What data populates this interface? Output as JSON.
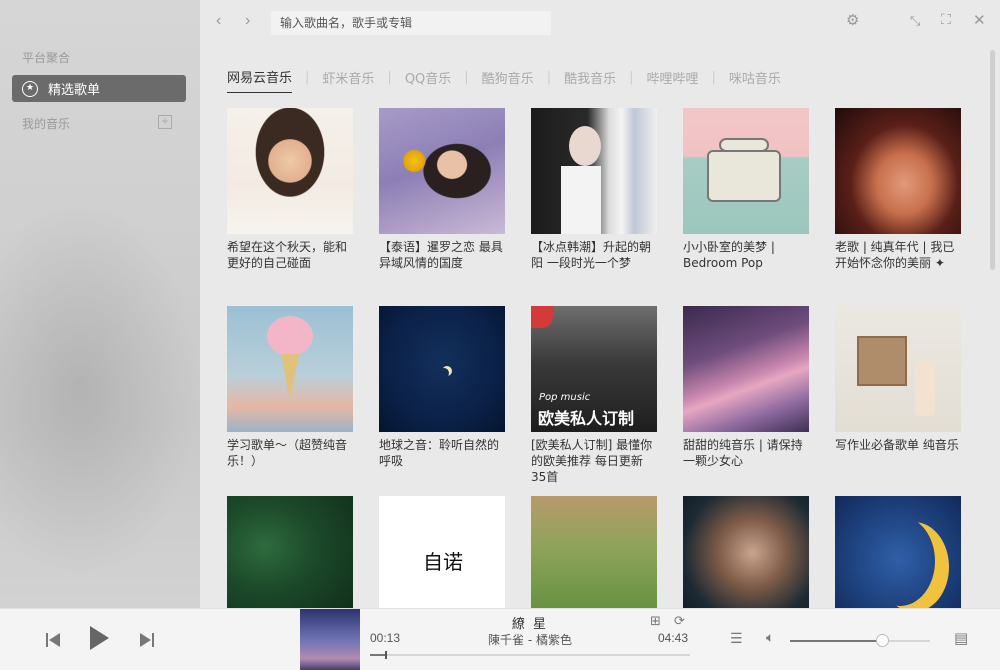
{
  "sidebar": {
    "section1": "平台聚合",
    "selected_item": "精选歌单",
    "section2": "我的音乐"
  },
  "topbar": {
    "search_placeholder": "输入歌曲名，歌手或专辑"
  },
  "tabs": [
    {
      "label": "网易云音乐",
      "active": true
    },
    {
      "label": "虾米音乐",
      "active": false
    },
    {
      "label": "QQ音乐",
      "active": false
    },
    {
      "label": "酷狗音乐",
      "active": false
    },
    {
      "label": "酷我音乐",
      "active": false
    },
    {
      "label": "哔哩哔哩",
      "active": false
    },
    {
      "label": "咪咕音乐",
      "active": false
    }
  ],
  "playlists": [
    {
      "title": "希望在这个秋天，能和更好的自己碰面",
      "cover_text": ""
    },
    {
      "title": "【泰语】暹罗之恋 最具异域风情的国度",
      "cover_text": ""
    },
    {
      "title": "【冰点韩潮】升起的朝阳 一段时光一个梦",
      "cover_text": ""
    },
    {
      "title": "小小卧室的美梦 | Bedroom Pop",
      "cover_text": ""
    },
    {
      "title": "老歌 | 纯真年代 | 我已开始怀念你的美丽 ✦",
      "cover_text": ""
    },
    {
      "title": "学习歌单～（超赞纯音乐！）",
      "cover_text": ""
    },
    {
      "title": "地球之音：聆听自然的呼吸",
      "cover_text": ""
    },
    {
      "title": "[欧美私人订制] 最懂你的欧美推荐 每日更新35首",
      "cover_text": "Pop music",
      "cover_text2": "欧美私人订制"
    },
    {
      "title": "甜甜的纯音乐 | 请保持一颗少女心",
      "cover_text": ""
    },
    {
      "title": "写作业必备歌单 纯音乐",
      "cover_text": ""
    },
    {
      "title": "",
      "cover_text": ""
    },
    {
      "title": "",
      "cover_text": "自诺"
    },
    {
      "title": "",
      "cover_text": ""
    },
    {
      "title": "",
      "cover_text": ""
    },
    {
      "title": "",
      "cover_text": ""
    }
  ],
  "player": {
    "song_title": "繚 星",
    "artist": "陳千雀 - 橘紫色",
    "elapsed": "00:13",
    "duration": "04:43",
    "progress": 0.046,
    "volume": 0.66
  },
  "colors": {
    "sidebar_selected": "#6b6b6b",
    "accent": "#333333"
  }
}
